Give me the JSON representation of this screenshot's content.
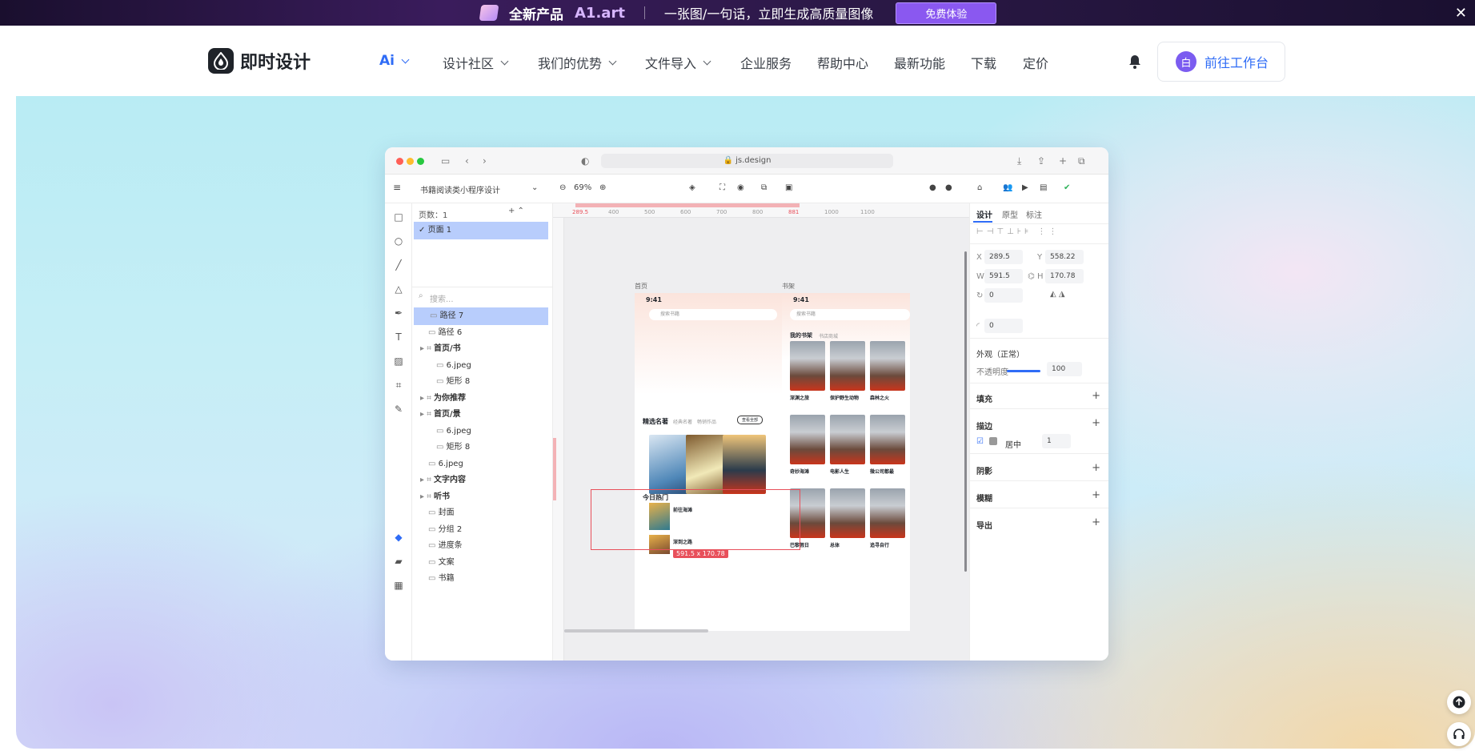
{
  "banner": {
    "new_product": "全新产品",
    "brand": "A1.art",
    "slogan": "一张图/一句话，立即生成高质量图像",
    "cta": "免费体验"
  },
  "nav": {
    "logo_text": "即时设计",
    "items": [
      {
        "label": "Ai",
        "has_dropdown": true
      },
      {
        "label": "设计社区",
        "has_dropdown": true
      },
      {
        "label": "我们的优势",
        "has_dropdown": true
      },
      {
        "label": "文件导入",
        "has_dropdown": true
      },
      {
        "label": "企业服务",
        "has_dropdown": false
      },
      {
        "label": "帮助中心",
        "has_dropdown": false
      },
      {
        "label": "最新功能",
        "has_dropdown": false
      },
      {
        "label": "下载",
        "has_dropdown": false
      },
      {
        "label": "定价",
        "has_dropdown": false
      }
    ],
    "avatar_letter": "白",
    "workbench_label": "前往工作台"
  },
  "editor": {
    "url": "js.design",
    "file_name": "书籍阅读类小程序设计",
    "zoom": "69%",
    "pages_label": "页数：1",
    "page_item": "页面 1",
    "search_placeholder": "搜索...",
    "layers": [
      {
        "label": "路径 7",
        "selected": true,
        "indent": 1
      },
      {
        "label": "路径 6",
        "selected": false,
        "indent": 1
      },
      {
        "label": "首页/书",
        "selected": false,
        "indent": 0
      },
      {
        "label": "6.jpeg",
        "selected": false,
        "indent": 2
      },
      {
        "label": "矩形 8",
        "selected": false,
        "indent": 2
      },
      {
        "label": "为你推荐",
        "selected": false,
        "indent": 0
      },
      {
        "label": "首页/景",
        "selected": false,
        "indent": 0
      },
      {
        "label": "6.jpeg",
        "selected": false,
        "indent": 2
      },
      {
        "label": "矩形 8",
        "selected": false,
        "indent": 2
      },
      {
        "label": "6.jpeg",
        "selected": false,
        "indent": 1
      },
      {
        "label": "文字内容",
        "selected": false,
        "indent": 0
      },
      {
        "label": "听书",
        "selected": false,
        "indent": 0
      },
      {
        "label": "封面",
        "selected": false,
        "indent": 1
      },
      {
        "label": "分组 2",
        "selected": false,
        "indent": 1
      },
      {
        "label": "进度条",
        "selected": false,
        "indent": 1
      },
      {
        "label": "文案",
        "selected": false,
        "indent": 1
      },
      {
        "label": "书籍",
        "selected": false,
        "indent": 1
      }
    ],
    "ruler_ticks": [
      "289.5",
      "400",
      "500",
      "600",
      "700",
      "800",
      "881",
      "1000",
      "1100"
    ],
    "frames": [
      {
        "title": "首页",
        "time": "9:41",
        "search": "搜索书籍",
        "section": "精选名著",
        "tabs": [
          "经典名著",
          "畅销作品"
        ],
        "more": "查看全部",
        "hot": "今日热门",
        "hot_items": [
          "前往海滩",
          "深到之路"
        ]
      },
      {
        "title": "书架",
        "time": "9:41",
        "search": "搜索书籍",
        "tabs": [
          "我的书架",
          "书店商城"
        ],
        "books": [
          "深渊之旅",
          "保护野生动物",
          "森林之火",
          "奇妙海滩",
          "电影人生",
          "微公司都最",
          "巴黎假日",
          "总体",
          "追寻自行"
        ]
      }
    ],
    "selection_size": "591.5 x 170.78",
    "props": {
      "tabs": [
        "设计",
        "原型",
        "标注"
      ],
      "x": "289.5",
      "y": "558.22",
      "w": "591.5",
      "h": "170.78",
      "rotation": "0",
      "radius": "0",
      "appearance": "外观（正常）",
      "opacity_label": "不透明度",
      "opacity": "100",
      "fill": "填充",
      "stroke": "描边",
      "stroke_align": "居中",
      "stroke_width": "1",
      "shadow": "阴影",
      "blur": "模糊",
      "export": "导出"
    }
  },
  "colors": {
    "accent": "#2f6cf6",
    "selection": "#e8505b",
    "layer_selected": "#b8cdfc"
  }
}
